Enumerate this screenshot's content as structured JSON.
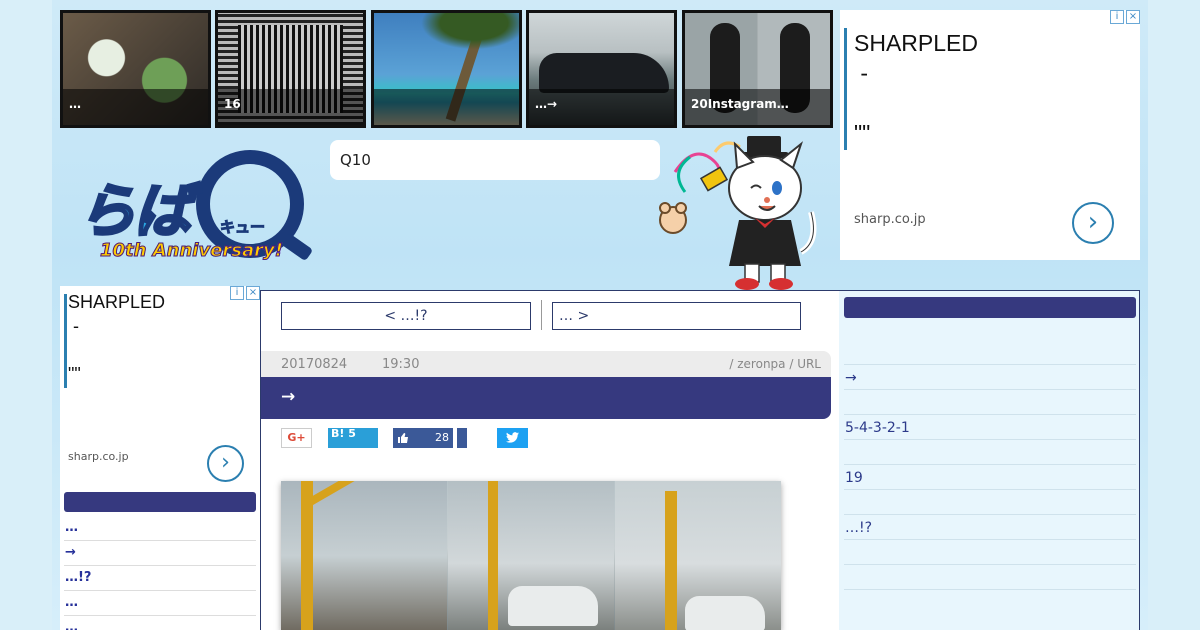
{
  "thumbnails": [
    {
      "caption": "…",
      "icon": "food-photo"
    },
    {
      "caption": "16",
      "icon": "pattern-photo"
    },
    {
      "caption": "",
      "icon": "beach-photo"
    },
    {
      "caption": "…→",
      "icon": "car-photo"
    },
    {
      "caption": "20Instagram…",
      "icon": "fitness-photo"
    }
  ],
  "ad_top": {
    "headline": "SHARPLED\n -\n\n\"\"",
    "domain": "sharp.co.jp",
    "go": "›",
    "info": "i",
    "close": "×"
  },
  "ad_left": {
    "headline": "SHARPLED\n -\n\n\"\"",
    "domain": "sharp.co.jp",
    "go": "›",
    "info": "i",
    "close": "×"
  },
  "logo": {
    "kana": "らば",
    "cue": "キュー",
    "anniversary": "10th Anniversary!"
  },
  "search": {
    "value": "Q10"
  },
  "nav": {
    "prev": "< …!?",
    "next": "… >"
  },
  "post": {
    "date": "20170824",
    "time": "19:30",
    "author": "/ zeronpa / URL",
    "title": "→"
  },
  "share": {
    "google": "G+",
    "hatena": "B! 5",
    "facebook_count": "28",
    "twitter": "t"
  },
  "right_sidebar": {
    "items": [
      "",
      "→",
      "",
      "5-4-3-2-1",
      "",
      "19",
      "",
      "…!?",
      "",
      ""
    ]
  },
  "left_sidebar": {
    "items": [
      "…",
      "→",
      "…!?",
      "…",
      "…"
    ]
  },
  "colors": {
    "accent": "#36397f",
    "link": "#2c3a8a",
    "ad_accent": "#2b7fb0"
  }
}
